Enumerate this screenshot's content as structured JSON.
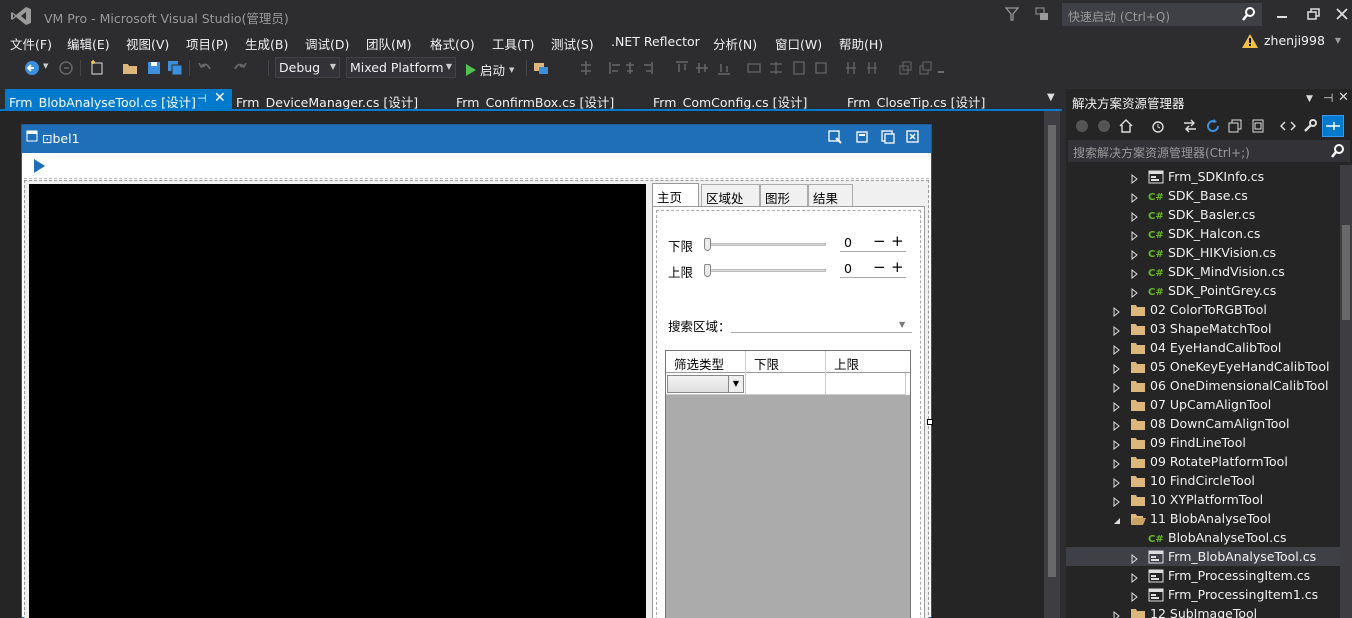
{
  "window": {
    "title": "VM Pro - Microsoft Visual Studio(管理员)",
    "quick_launch_placeholder": "快速启动 (Ctrl+Q)",
    "user": "zhenji998"
  },
  "menu": [
    "文件(F)",
    "编辑(E)",
    "视图(V)",
    "项目(P)",
    "生成(B)",
    "调试(D)",
    "团队(M)",
    "格式(O)",
    "工具(T)",
    "测试(S)",
    ".NET Reflector",
    "分析(N)",
    "窗口(W)",
    "帮助(H)"
  ],
  "toolbar": {
    "config": "Debug",
    "platform": "Mixed Platform",
    "start": "启动"
  },
  "tabs": [
    {
      "label": "Frm_BlobAnalyseTool.cs [设计]",
      "active": true
    },
    {
      "label": "Frm_DeviceManager.cs [设计]"
    },
    {
      "label": "Frm_ConfirmBox.cs [设计]"
    },
    {
      "label": "Frm_ComConfig.cs [设计]"
    },
    {
      "label": "Frm_CloseTip.cs [设计]"
    }
  ],
  "form": {
    "title": "bel1",
    "tabs": [
      "主页面",
      "区域处理",
      "图形",
      "结果"
    ],
    "lower_label": "下限",
    "upper_label": "上限",
    "lower_value": "0",
    "upper_value": "0",
    "search_label": "搜索区域：",
    "grid_headers": [
      "筛选类型",
      "下限",
      "上限"
    ]
  },
  "solution_explorer": {
    "title": "解决方案资源管理器",
    "search_placeholder": "搜索解决方案资源管理器(Ctrl+;)",
    "nodes": [
      {
        "label": "Frm_SDKInfo.cs",
        "icon": "form-icon",
        "indent": 2,
        "exp": "collapsed"
      },
      {
        "label": "SDK_Base.cs",
        "icon": "csharp-icon",
        "indent": 2,
        "exp": "collapsed"
      },
      {
        "label": "SDK_Basler.cs",
        "icon": "csharp-icon",
        "indent": 2,
        "exp": "collapsed"
      },
      {
        "label": "SDK_Halcon.cs",
        "icon": "csharp-icon",
        "indent": 2,
        "exp": "collapsed"
      },
      {
        "label": "SDK_HIKVision.cs",
        "icon": "csharp-icon",
        "indent": 2,
        "exp": "collapsed"
      },
      {
        "label": "SDK_MindVision.cs",
        "icon": "csharp-icon",
        "indent": 2,
        "exp": "collapsed"
      },
      {
        "label": "SDK_PointGrey.cs",
        "icon": "csharp-icon",
        "indent": 2,
        "exp": "collapsed"
      },
      {
        "label": "02 ColorToRGBTool",
        "icon": "folder-icon",
        "indent": 1,
        "exp": "collapsed"
      },
      {
        "label": "03 ShapeMatchTool",
        "icon": "folder-icon",
        "indent": 1,
        "exp": "collapsed"
      },
      {
        "label": "04 EyeHandCalibTool",
        "icon": "folder-icon",
        "indent": 1,
        "exp": "collapsed"
      },
      {
        "label": "05 OneKeyEyeHandCalibTool",
        "icon": "folder-icon",
        "indent": 1,
        "exp": "collapsed"
      },
      {
        "label": "06 OneDimensionalCalibTool",
        "icon": "folder-icon",
        "indent": 1,
        "exp": "collapsed"
      },
      {
        "label": "07 UpCamAlignTool",
        "icon": "folder-icon",
        "indent": 1,
        "exp": "collapsed"
      },
      {
        "label": "08 DownCamAlignTool",
        "icon": "folder-icon",
        "indent": 1,
        "exp": "collapsed"
      },
      {
        "label": "09 FindLineTool",
        "icon": "folder-icon",
        "indent": 1,
        "exp": "collapsed"
      },
      {
        "label": "09 RotatePlatformTool",
        "icon": "folder-icon",
        "indent": 1,
        "exp": "collapsed"
      },
      {
        "label": "10 FindCircleTool",
        "icon": "folder-icon",
        "indent": 1,
        "exp": "collapsed"
      },
      {
        "label": "10 XYPlatformTool",
        "icon": "folder-icon",
        "indent": 1,
        "exp": "collapsed"
      },
      {
        "label": "11 BlobAnalyseTool",
        "icon": "folder-open-icon",
        "indent": 1,
        "exp": "expanded"
      },
      {
        "label": "BlobAnalyseTool.cs",
        "icon": "csharp-icon",
        "indent": 2,
        "exp": "none"
      },
      {
        "label": "Frm_BlobAnalyseTool.cs",
        "icon": "form-icon",
        "indent": 2,
        "exp": "collapsed",
        "selected": true
      },
      {
        "label": "Frm_ProcessingItem.cs",
        "icon": "form-icon",
        "indent": 2,
        "exp": "collapsed"
      },
      {
        "label": "Frm_ProcessingItem1.cs",
        "icon": "form-icon",
        "indent": 2,
        "exp": "collapsed"
      },
      {
        "label": "12 SubImageTool",
        "icon": "folder-icon",
        "indent": 1,
        "exp": "collapsed"
      }
    ]
  },
  "colors": {
    "accent": "#007acc",
    "form_title": "#1e6fb8",
    "folder": "#dcb67a",
    "csharp": "#68b723"
  }
}
